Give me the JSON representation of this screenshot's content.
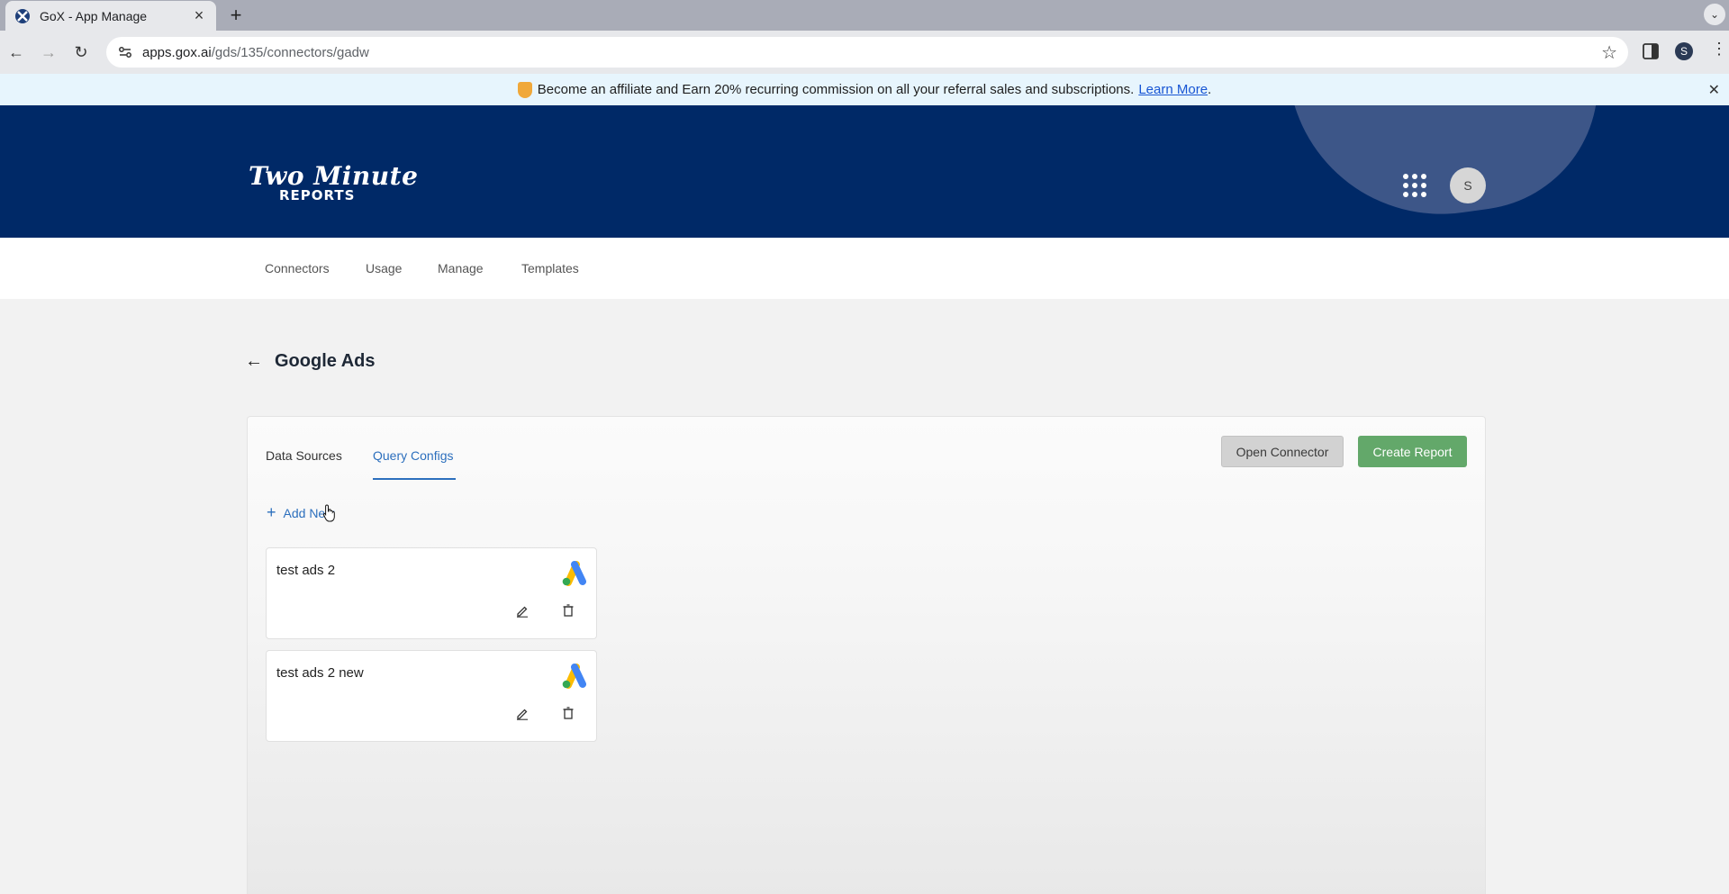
{
  "browser": {
    "tab_title": "GoX - App Manage",
    "url_host": "apps.gox.ai",
    "url_path": "/gds/135/connectors/gadw",
    "profile_initial": "S"
  },
  "banner": {
    "text": "Become an affiliate and Earn 20% recurring commission on all your referral sales and subscriptions.",
    "link": "Learn More",
    "after_link": "."
  },
  "header": {
    "logo_line1": "Two Minute",
    "logo_line2": "REPORTS",
    "avatar_initial": "S"
  },
  "nav": {
    "items": [
      "Connectors",
      "Usage",
      "Manage",
      "Templates"
    ]
  },
  "page": {
    "title": "Google Ads",
    "tabs": [
      "Data Sources",
      "Query Configs"
    ],
    "active_tab": "Query Configs",
    "open_connector": "Open Connector",
    "create_report": "Create Report",
    "add_new": "Add New"
  },
  "configs": [
    {
      "name": "test ads 2"
    },
    {
      "name": "test ads 2 new"
    }
  ],
  "colors": {
    "header_bg": "#002967",
    "accent_blue": "#2c6fbd",
    "create_green": "#63a86a"
  }
}
